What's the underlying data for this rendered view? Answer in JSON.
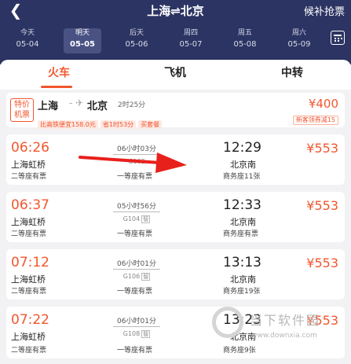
{
  "header": {
    "back_icon": "chevron-left-icon",
    "title": "上海⇌北京",
    "waitlist": "候补抢票"
  },
  "days": [
    {
      "week": "今天",
      "date": "05-04",
      "selected": false
    },
    {
      "week": "明天",
      "date": "05-05",
      "selected": true
    },
    {
      "week": "后天",
      "date": "05-06",
      "selected": false
    },
    {
      "week": "周四",
      "date": "05-07",
      "selected": false
    },
    {
      "week": "周五",
      "date": "05-08",
      "selected": false
    },
    {
      "week": "周六",
      "date": "05-09",
      "selected": false
    }
  ],
  "tabs": [
    "火车",
    "飞机",
    "中转"
  ],
  "promo": {
    "tag_line1": "特价",
    "tag_line2": "机票",
    "from": "上海",
    "to": "北京",
    "duration": "2时25分",
    "chips": [
      "比高铁便宜158.0元",
      "省1时53分",
      "买套餐"
    ],
    "price": "¥400",
    "gift": "新客领券减15"
  },
  "trains": [
    {
      "dep": "06:26",
      "arr": "12:29",
      "from": "上海虹桥",
      "to": "北京南",
      "duration": "06小时03分",
      "train_no": "G102",
      "badge": "",
      "price": "¥553",
      "seat1": "二等座有票",
      "seat2": "一等座有票",
      "seat3": "商务座11张"
    },
    {
      "dep": "06:37",
      "arr": "12:33",
      "from": "上海虹桥",
      "to": "北京南",
      "duration": "05小时56分",
      "train_no": "G104",
      "badge": "智",
      "price": "¥553",
      "seat1": "二等座有票",
      "seat2": "一等座有票",
      "seat3": "商务座有票"
    },
    {
      "dep": "07:12",
      "arr": "13:13",
      "from": "上海虹桥",
      "to": "北京南",
      "duration": "06小时01分",
      "train_no": "G106",
      "badge": "智",
      "price": "¥553",
      "seat1": "二等座有票",
      "seat2": "一等座有票",
      "seat3": "商务座19张"
    },
    {
      "dep": "07:22",
      "arr": "13:23",
      "from": "上海虹桥",
      "to": "北京南",
      "duration": "06小时01分",
      "train_no": "G108",
      "badge": "智",
      "price": "¥553",
      "seat1": "二等座有票",
      "seat2": "一等座有票",
      "seat3": "商务座9张"
    }
  ],
  "watermark": {
    "text": "当下软件园",
    "url": "www.downxia.com"
  },
  "colors": {
    "header": "#2c3463",
    "accent": "#f2562e"
  }
}
